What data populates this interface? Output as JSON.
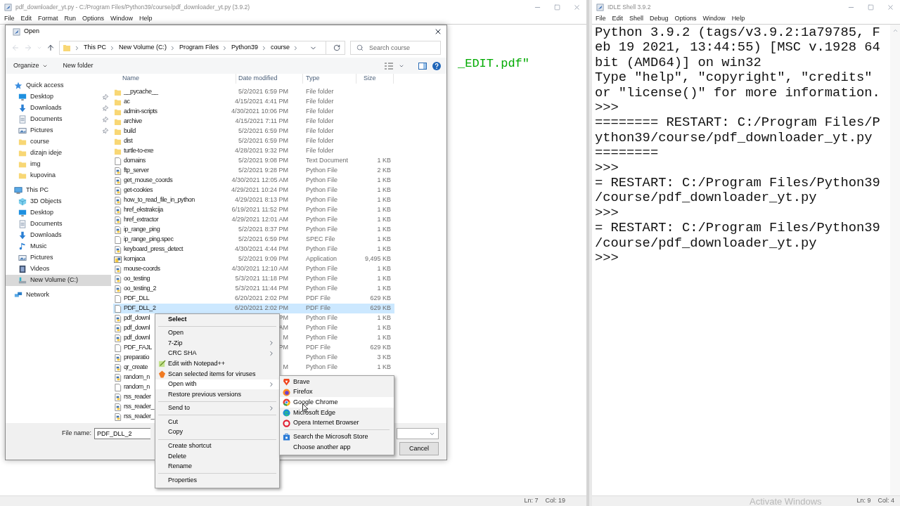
{
  "editor": {
    "title": "pdf_downloader_yt.py - C:/Program Files/Python39/course/pdf_downloader_yt.py (3.9.2)",
    "menu": [
      "File",
      "Edit",
      "Format",
      "Run",
      "Options",
      "Window",
      "Help"
    ],
    "code_fragment": "_EDIT.pdf\"",
    "status": [
      "Ln: 7",
      "Col: 19"
    ]
  },
  "dialog": {
    "title": "Open",
    "breadcrumb": [
      "This PC",
      "New Volume (C:)",
      "Program Files",
      "Python39",
      "course"
    ],
    "search": {
      "placeholder": "Search course"
    },
    "toolbar": [
      "Organize",
      "New folder"
    ],
    "sidebar": [
      {
        "label": "Quick access",
        "kind": "star",
        "selected": false,
        "children": [
          {
            "label": "Desktop",
            "kind": "desktop",
            "pinned": true,
            "selected": false
          },
          {
            "label": "Downloads",
            "kind": "downloads",
            "pinned": true,
            "selected": false
          },
          {
            "label": "Documents",
            "kind": "documents",
            "pinned": true,
            "selected": false
          },
          {
            "label": "Pictures",
            "kind": "pictures",
            "pinned": true,
            "selected": false
          },
          {
            "label": "course",
            "kind": "folder",
            "pinned": false,
            "selected": false
          },
          {
            "label": "dizajn ideje",
            "kind": "folder",
            "pinned": false,
            "selected": false
          },
          {
            "label": "img",
            "kind": "folder",
            "pinned": false,
            "selected": false
          },
          {
            "label": "kupovina",
            "kind": "folder",
            "pinned": false,
            "selected": false
          }
        ]
      },
      {
        "label": "This PC",
        "kind": "pc",
        "selected": false,
        "children": [
          {
            "label": "3D Objects",
            "kind": "objects",
            "pinned": false,
            "selected": false
          },
          {
            "label": "Desktop",
            "kind": "desktop",
            "pinned": false,
            "selected": false
          },
          {
            "label": "Documents",
            "kind": "documents",
            "pinned": false,
            "selected": false
          },
          {
            "label": "Downloads",
            "kind": "downloads",
            "pinned": false,
            "selected": false
          },
          {
            "label": "Music",
            "kind": "music",
            "pinned": false,
            "selected": false
          },
          {
            "label": "Pictures",
            "kind": "pictures",
            "pinned": false,
            "selected": false
          },
          {
            "label": "Videos",
            "kind": "videos",
            "pinned": false,
            "selected": false
          },
          {
            "label": "New Volume (C:)",
            "kind": "drive",
            "pinned": false,
            "selected": true
          }
        ]
      },
      {
        "label": "Network",
        "kind": "network",
        "selected": false
      }
    ],
    "columns": [
      "Name",
      "Date modified",
      "Type",
      "Size"
    ],
    "files": [
      {
        "name": "__pycache__",
        "kind": "folder",
        "date": "5/2/2021 6:59 PM",
        "type": "File folder",
        "selected": false
      },
      {
        "name": "ac",
        "kind": "folder",
        "date": "4/15/2021 4:41 PM",
        "type": "File folder",
        "selected": false
      },
      {
        "name": "admin-scripts",
        "kind": "folder",
        "date": "4/30/2021 10:06 PM",
        "type": "File folder",
        "selected": false
      },
      {
        "name": "archive",
        "kind": "folder",
        "date": "4/15/2021 7:11 PM",
        "type": "File folder",
        "selected": false
      },
      {
        "name": "build",
        "kind": "folder",
        "date": "5/2/2021 6:59 PM",
        "type": "File folder",
        "selected": false
      },
      {
        "name": "dist",
        "kind": "folder",
        "date": "5/2/2021 6:59 PM",
        "type": "File folder",
        "selected": false
      },
      {
        "name": "turtle-to-exe",
        "kind": "folder",
        "date": "4/28/2021 9:32 PM",
        "type": "File folder",
        "selected": false
      },
      {
        "name": "domains",
        "kind": "text",
        "date": "5/2/2021 9:08 PM",
        "type": "Text Document",
        "size": "1 KB",
        "selected": false
      },
      {
        "name": "ftp_server",
        "kind": "python",
        "date": "5/2/2021 9:28 PM",
        "type": "Python File",
        "size": "2 KB",
        "selected": false
      },
      {
        "name": "get_mouse_coords",
        "kind": "python",
        "date": "4/30/2021 12:05 AM",
        "type": "Python File",
        "size": "1 KB",
        "selected": false
      },
      {
        "name": "get-cookies",
        "kind": "python",
        "date": "4/29/2021 10:24 PM",
        "type": "Python File",
        "size": "1 KB",
        "selected": false
      },
      {
        "name": "how_to_read_file_in_python",
        "kind": "python",
        "date": "4/29/2021 8:13 PM",
        "type": "Python File",
        "size": "1 KB",
        "selected": false
      },
      {
        "name": "href_ekstrakcija",
        "kind": "python",
        "date": "6/19/2021 11:52 PM",
        "type": "Python File",
        "size": "1 KB",
        "selected": false
      },
      {
        "name": "href_extractor",
        "kind": "python",
        "date": "4/29/2021 12:01 AM",
        "type": "Python File",
        "size": "1 KB",
        "selected": false
      },
      {
        "name": "ip_range_ping",
        "kind": "python",
        "date": "5/2/2021 8:37 PM",
        "type": "Python File",
        "size": "1 KB",
        "selected": false
      },
      {
        "name": "ip_range_ping.spec",
        "kind": "text",
        "date": "5/2/2021 6:59 PM",
        "type": "SPEC File",
        "size": "1 KB",
        "selected": false
      },
      {
        "name": "keyboard_press_detect",
        "kind": "python",
        "date": "4/30/2021 4:44 PM",
        "type": "Python File",
        "size": "1 KB",
        "selected": false
      },
      {
        "name": "kornjaca",
        "kind": "app",
        "date": "5/2/2021 9:09 PM",
        "type": "Application",
        "size": "9,495 KB",
        "selected": false
      },
      {
        "name": "mouse-coords",
        "kind": "python",
        "date": "4/30/2021 12:10 AM",
        "type": "Python File",
        "size": "1 KB",
        "selected": false
      },
      {
        "name": "oo_testing",
        "kind": "python",
        "date": "5/3/2021 11:18 PM",
        "type": "Python File",
        "size": "1 KB",
        "selected": false
      },
      {
        "name": "oo_testing_2",
        "kind": "python",
        "date": "5/3/2021 11:44 PM",
        "type": "Python File",
        "size": "1 KB",
        "selected": false
      },
      {
        "name": "PDF_DLL",
        "kind": "text",
        "date": "6/20/2021 2:02 PM",
        "type": "PDF File",
        "size": "629 KB",
        "selected": false
      },
      {
        "name": "PDF_DLL_2",
        "kind": "text",
        "date": "6/20/2021 2:02 PM",
        "type": "PDF File",
        "size": "629 KB",
        "selected": true
      },
      {
        "name": "pdf_downl",
        "kind": "python",
        "date": "PM",
        "type": "Python File",
        "size": "1 KB",
        "selected": false
      },
      {
        "name": "pdf_downl",
        "kind": "python",
        "date": "AM",
        "type": "Python File",
        "size": "1 KB",
        "selected": false
      },
      {
        "name": "pdf_downl",
        "kind": "python",
        "date": "M",
        "type": "Python File",
        "size": "1 KB",
        "selected": false
      },
      {
        "name": "PDF_FAJL",
        "kind": "text",
        "date": "PM",
        "type": "PDF File",
        "size": "629 KB",
        "selected": false
      },
      {
        "name": "preparatio",
        "kind": "python",
        "type": "Python File",
        "size": "3 KB",
        "selected": false
      },
      {
        "name": "qr_create",
        "kind": "python",
        "date": "M",
        "type": "Python File",
        "size": "1 KB",
        "selected": false
      },
      {
        "name": "random_n",
        "kind": "python",
        "selected": false
      },
      {
        "name": "random_n",
        "kind": "text",
        "selected": false
      },
      {
        "name": "rss_reader",
        "kind": "python",
        "selected": false
      },
      {
        "name": "rss_reader_",
        "kind": "python",
        "selected": false
      },
      {
        "name": "rss_reader_",
        "kind": "python",
        "selected": false
      }
    ],
    "file_name": {
      "label": "File name:",
      "value": "PDF_DLL_2"
    },
    "buttons": [
      "Cancel"
    ]
  },
  "context_menu": {
    "items": [
      {
        "kind": "item",
        "label": "Select",
        "default": true,
        "submenu": false,
        "selected": false
      },
      {
        "kind": "separator"
      },
      {
        "kind": "item",
        "label": "Open",
        "default": false,
        "submenu": false,
        "selected": false
      },
      {
        "kind": "item",
        "label": "7-Zip",
        "default": false,
        "submenu": true,
        "selected": false
      },
      {
        "kind": "item",
        "label": "CRC SHA",
        "default": false,
        "submenu": true,
        "selected": false
      },
      {
        "kind": "notepad",
        "label": "Edit with Notepad++",
        "default": false,
        "submenu": false,
        "selected": false
      },
      {
        "kind": "shield",
        "label": "Scan selected items for viruses",
        "default": false,
        "submenu": false,
        "selected": false
      },
      {
        "kind": "item",
        "label": "Open with",
        "default": false,
        "submenu": true,
        "selected": true
      },
      {
        "kind": "item",
        "label": "Restore previous versions",
        "default": false,
        "submenu": false,
        "selected": false
      },
      {
        "kind": "separator"
      },
      {
        "kind": "item",
        "label": "Send to",
        "default": false,
        "submenu": true,
        "selected": false
      },
      {
        "kind": "separator"
      },
      {
        "kind": "item",
        "label": "Cut",
        "default": false,
        "submenu": false,
        "selected": false
      },
      {
        "kind": "item",
        "label": "Copy",
        "default": false,
        "submenu": false,
        "selected": false
      },
      {
        "kind": "separator"
      },
      {
        "kind": "item",
        "label": "Create shortcut",
        "default": false,
        "submenu": false,
        "selected": false
      },
      {
        "kind": "item",
        "label": "Delete",
        "default": false,
        "submenu": false,
        "selected": false
      },
      {
        "kind": "item",
        "label": "Rename",
        "default": false,
        "submenu": false,
        "selected": false
      },
      {
        "kind": "separator"
      },
      {
        "kind": "item",
        "label": "Properties",
        "default": false,
        "submenu": false,
        "selected": false
      }
    ]
  },
  "open_with_menu": {
    "items": [
      {
        "kind": "brave",
        "label": "Brave",
        "selected": false
      },
      {
        "kind": "firefox",
        "label": "Firefox",
        "selected": false
      },
      {
        "kind": "chrome",
        "label": "Google Chrome",
        "selected": true
      },
      {
        "kind": "edge",
        "label": "Microsoft Edge",
        "selected": false
      },
      {
        "kind": "opera",
        "label": "Opera Internet Browser",
        "selected": false
      },
      {
        "kind": "separator"
      },
      {
        "kind": "store",
        "label": "Search the Microsoft Store",
        "selected": false
      },
      {
        "kind": "item",
        "label": "Choose another app",
        "selected": false
      }
    ]
  },
  "shell": {
    "title": "IDLE Shell 3.9.2",
    "menu": [
      "File",
      "Edit",
      "Shell",
      "Debug",
      "Options",
      "Window",
      "Help"
    ],
    "lines": [
      "Python 3.9.2 (tags/v3.9.2:1a79785, F",
      "eb 19 2021, 13:44:55) [MSC v.1928 64",
      "bit (AMD64)] on win32",
      "Type \"help\", \"copyright\", \"credits\"",
      "or \"license()\" for more information.",
      ">>>",
      "======== RESTART: C:/Program Files/P",
      "ython39/course/pdf_downloader_yt.py",
      "========",
      ">>>",
      "= RESTART: C:/Program Files/Python39",
      "/course/pdf_downloader_yt.py",
      ">>>",
      "= RESTART: C:/Program Files/Python39",
      "/course/pdf_downloader_yt.py",
      ">>>"
    ],
    "status": [
      "Ln: 9",
      "Col: 4"
    ]
  },
  "os_notice": "Activate Windows"
}
